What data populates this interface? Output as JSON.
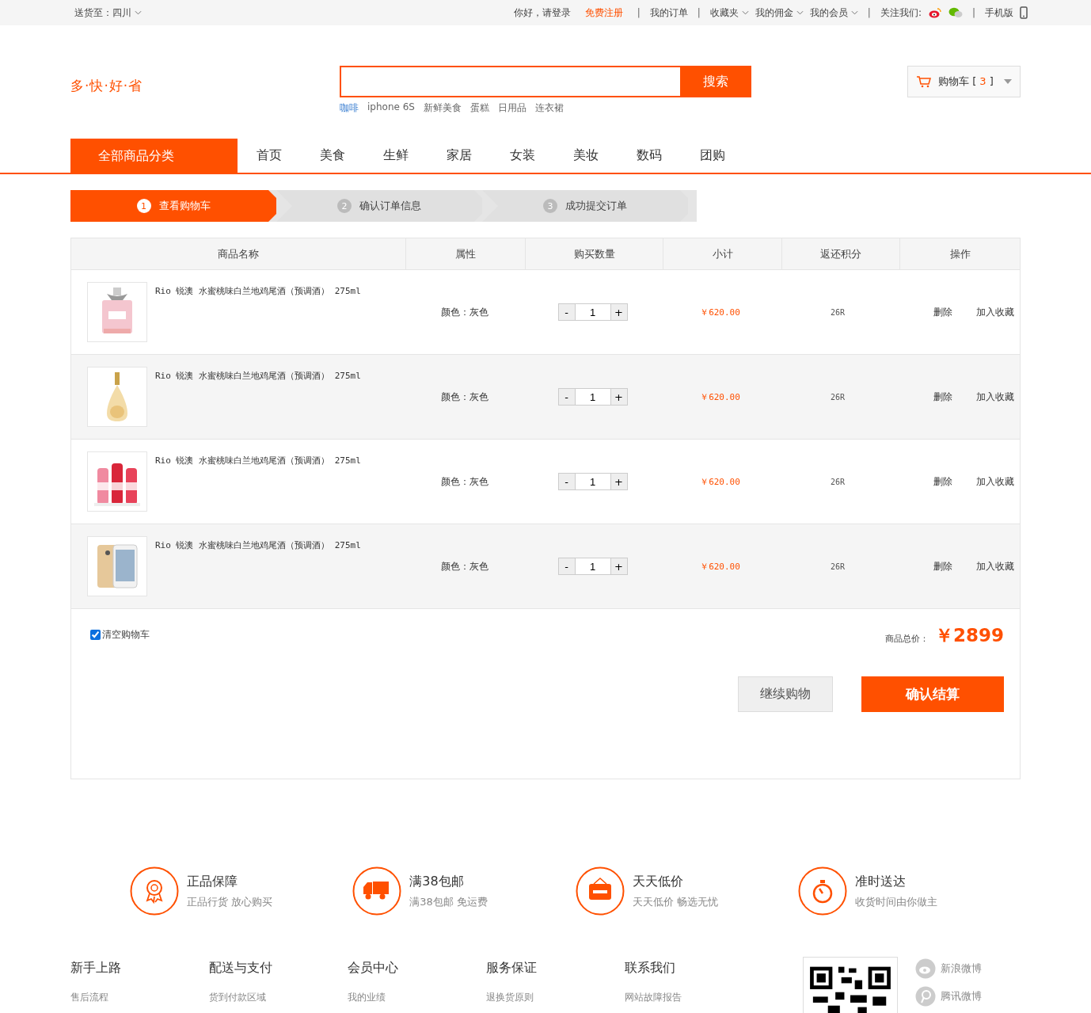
{
  "topbar": {
    "location": "送货至：四川",
    "links": [
      {
        "label": "你好，请登录",
        "kind": "plain"
      },
      {
        "label": "免费注册",
        "kind": "highlight"
      },
      {
        "label": "|",
        "kind": "separator"
      },
      {
        "label": "我的订单",
        "kind": "plain"
      },
      {
        "label": "|",
        "kind": "separator"
      },
      {
        "label": "收藏夹",
        "kind": "dropdown"
      },
      {
        "label": "我的佣金",
        "kind": "dropdown"
      },
      {
        "label": "我的会员",
        "kind": "dropdown"
      },
      {
        "label": "|",
        "kind": "separator"
      },
      {
        "label": "关注我们:",
        "kind": "label"
      },
      {
        "kind": "weibo"
      },
      {
        "kind": "wechat"
      },
      {
        "label": "|",
        "kind": "separator"
      },
      {
        "label": "手机版",
        "kind": "mobile"
      }
    ]
  },
  "header": {
    "logo": "多·快·好·省",
    "search_button": "搜索",
    "hot_words": [
      "咖啡",
      "iphone 6S",
      "新鲜美食",
      "蛋糕",
      "日用品",
      "连衣裙"
    ],
    "cart_label": "购物车",
    "cart_open": "[",
    "cart_count": "3",
    "cart_close": "]"
  },
  "nav": {
    "category": "全部商品分类",
    "items": [
      "首页",
      "美食",
      "生鲜",
      "家居",
      "女装",
      "美妆",
      "数码",
      "团购"
    ]
  },
  "steps": [
    {
      "number": "1",
      "label": "查看购物车",
      "selected": true
    },
    {
      "number": "2",
      "label": "确认订单信息",
      "selected": false
    },
    {
      "number": "3",
      "label": "成功提交订单",
      "selected": false
    }
  ],
  "table": {
    "columns": [
      "商品名称",
      "属性",
      "购买数量",
      "小计",
      "返还积分",
      "操作"
    ],
    "rows": [
      {
        "name": "Rio 锐澳 水蜜桃味白兰地鸡尾酒（预调酒） 275ml",
        "attribute": "颜色：灰色",
        "minus": "-",
        "quantity": "1",
        "plus": "+",
        "subtotal": "￥620.00",
        "points": "26R",
        "delete": "删除",
        "favorite": "加入收藏",
        "kind": "perfume"
      },
      {
        "name": "Rio 锐澳 水蜜桃味白兰地鸡尾酒（预调酒） 275ml",
        "attribute": "颜色：灰色",
        "minus": "-",
        "quantity": "1",
        "plus": "+",
        "subtotal": "￥620.00",
        "points": "26R",
        "delete": "删除",
        "favorite": "加入收藏",
        "kind": "bottle"
      },
      {
        "name": "Rio 锐澳 水蜜桃味白兰地鸡尾酒（预调酒） 275ml",
        "attribute": "颜色：灰色",
        "minus": "-",
        "quantity": "1",
        "plus": "+",
        "subtotal": "￥620.00",
        "points": "26R",
        "delete": "删除",
        "favorite": "加入收藏",
        "kind": "drinks"
      },
      {
        "name": "Rio 锐澳 水蜜桃味白兰地鸡尾酒（预调酒） 275ml",
        "attribute": "颜色：灰色",
        "minus": "-",
        "quantity": "1",
        "plus": "+",
        "subtotal": "￥620.00",
        "points": "26R",
        "delete": "删除",
        "favorite": "加入收藏",
        "kind": "phone"
      }
    ]
  },
  "summary": {
    "clear_cart": {
      "label": "清空购物车",
      "checked": true
    },
    "total_label": "商品总价：",
    "total": "￥2899",
    "continue_button": "继续购物",
    "checkout_button": "确认结算"
  },
  "services": [
    {
      "title": "正品保障",
      "subtitle": "正品行货 放心购买",
      "kind": "badge"
    },
    {
      "title": "满38包邮",
      "subtitle": "满38包邮 免运费",
      "kind": "truck"
    },
    {
      "title": "天天低价",
      "subtitle": "天天低价 畅选无忧",
      "kind": "sale"
    },
    {
      "title": "准时送达",
      "subtitle": "收货时间由你做主",
      "kind": "timer"
    }
  ],
  "footer": {
    "columns": [
      {
        "heading": "新手上路",
        "link": "售后流程"
      },
      {
        "heading": "配送与支付",
        "link": "货到付款区域"
      },
      {
        "heading": "会员中心",
        "link": "我的业绩"
      },
      {
        "heading": "服务保证",
        "link": "退换货原则"
      },
      {
        "heading": "联系我们",
        "link": "网站故障报告"
      }
    ],
    "social": [
      {
        "label": "新浪微博",
        "kind": "weibo"
      },
      {
        "label": "腾讯微博",
        "kind": "tencent"
      }
    ]
  }
}
